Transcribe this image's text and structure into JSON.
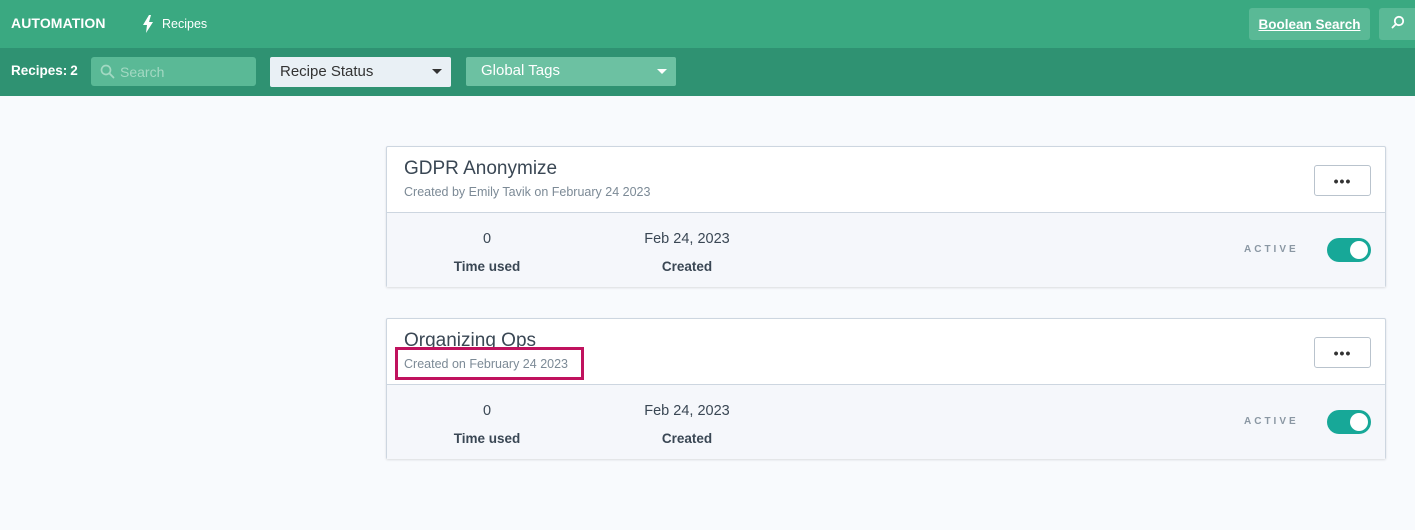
{
  "header": {
    "brand": "AUTOMATION",
    "nav_recipes_label": "Recipes",
    "boolean_search_label": "Boolean Search"
  },
  "filters": {
    "recipes_label": "Recipes:",
    "recipes_count": "2",
    "search_placeholder": "Search",
    "status_value": "Recipe Status",
    "tags_value": "Global Tags"
  },
  "recipes": [
    {
      "title": "GDPR Anonymize",
      "subtitle": "Created by Emily Tavik on February 24 2023",
      "times_used": "0",
      "times_used_label": "Time used",
      "created": "Feb 24, 2023",
      "created_label": "Created",
      "status": "ACTIVE",
      "more_label": "•••"
    },
    {
      "title": "Organizing Ops",
      "subtitle": "Created on February 24 2023",
      "times_used": "0",
      "times_used_label": "Time used",
      "created": "Feb 24, 2023",
      "created_label": "Created",
      "status": "ACTIVE",
      "more_label": "•••"
    }
  ],
  "colors": {
    "topbar": "#3aa981",
    "filterbar": "#2f9272",
    "toggle_on": "#17a898",
    "highlight": "#c0125e"
  }
}
